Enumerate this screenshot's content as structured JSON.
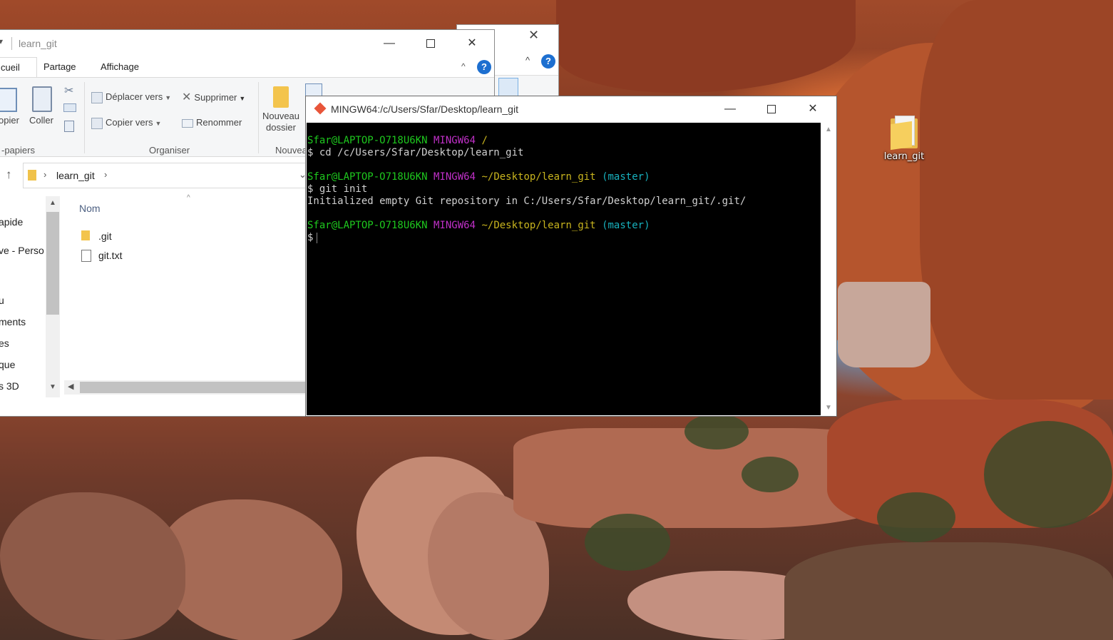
{
  "desktop": {
    "folder_label": "learn_git"
  },
  "explorer_back": {
    "close_glyph": "✕",
    "chevron_glyph": "^",
    "help_glyph": "?"
  },
  "explorer": {
    "title": "learn_git",
    "tabs": [
      "cueil",
      "Partage",
      "Affichage"
    ],
    "help_glyph": "?",
    "ribbon": {
      "copy_label": "opier",
      "paste_label": "Coller",
      "move_to_label": "Déplacer vers",
      "copy_to_label": "Copier vers",
      "delete_label": "Supprimer",
      "rename_label": "Renommer",
      "new_folder_label": "Nouveau dossier",
      "new_group_label": "Nouvea",
      "group_clipboard": "-papiers",
      "group_organize": "Organiser"
    },
    "address": {
      "crumb": "learn_git"
    },
    "nav_items": [
      "apide",
      "ve - Perso",
      "u",
      "ments",
      "es",
      "que",
      "s 3D"
    ],
    "column_header": "Nom",
    "files": [
      {
        "name": ".git",
        "icon": "folder-icon"
      },
      {
        "name": "git.txt",
        "icon": "text-file-icon"
      }
    ]
  },
  "terminal": {
    "title": "MINGW64:/c/Users/Sfar/Desktop/learn_git",
    "lines": {
      "l1_user": "Sfar@LAPTOP-O718U6KN",
      "l1_sys": "MINGW64",
      "l1_path": "/",
      "l2": "$ cd /c/Users/Sfar/Desktop/learn_git",
      "l3_user": "Sfar@LAPTOP-O718U6KN",
      "l3_sys": "MINGW64",
      "l3_path": "~/Desktop/learn_git",
      "l3_branch": "(master)",
      "l4": "$ git init",
      "l5": "Initialized empty Git repository in C:/Users/Sfar/Desktop/learn_git/.git/",
      "l6_user": "Sfar@LAPTOP-O718U6KN",
      "l6_sys": "MINGW64",
      "l6_path": "~/Desktop/learn_git",
      "l6_branch": "(master)",
      "l7": "$"
    }
  },
  "colors": {
    "prompt_user": "#1ec81e",
    "prompt_system": "#c030c8",
    "prompt_path": "#c8b41e",
    "prompt_branch": "#18b2bf",
    "help_blue": "#1d6fd0"
  }
}
